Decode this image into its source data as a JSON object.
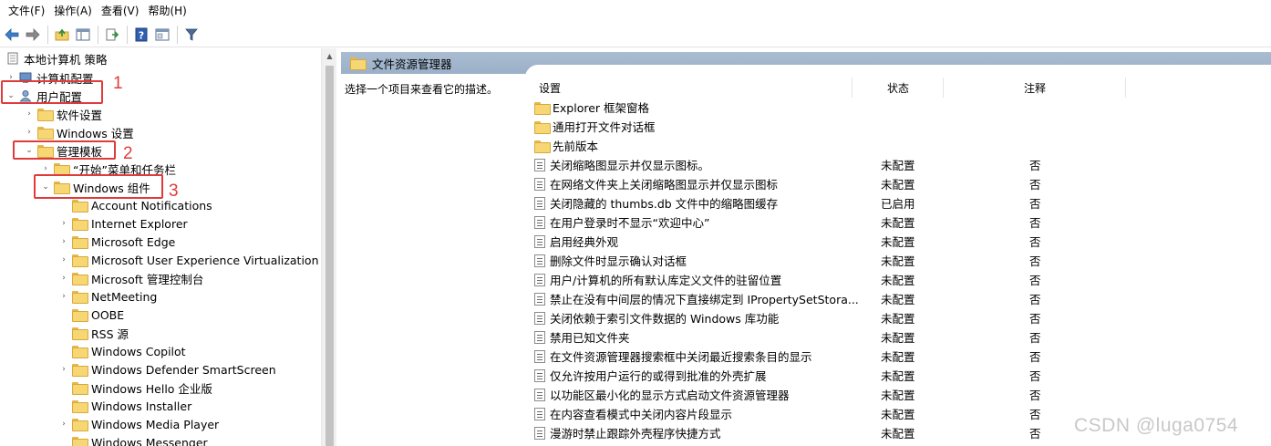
{
  "menu": [
    "文件(F)",
    "操作(A)",
    "查看(V)",
    "帮助(H)"
  ],
  "toolbar": [
    "back-icon",
    "forward-icon",
    "up-folder-icon",
    "show-hide-tree-icon",
    "export-list-icon",
    "help-icon",
    "properties-icon",
    "filter-icon"
  ],
  "tree": {
    "root": "本地计算机 策略",
    "items": [
      {
        "label": "计算机配置",
        "expander": "›"
      },
      {
        "label": "用户配置",
        "expander": "⌄"
      },
      {
        "label": "软件设置",
        "expander": "›"
      },
      {
        "label": "Windows 设置",
        "expander": "›"
      },
      {
        "label": "管理模板",
        "expander": "⌄"
      },
      {
        "label": "“开始”菜单和任务栏",
        "expander": "›"
      },
      {
        "label": "Windows 组件",
        "expander": "⌄"
      },
      {
        "label": "Account Notifications",
        "expander": ""
      },
      {
        "label": "Internet Explorer",
        "expander": "›"
      },
      {
        "label": "Microsoft Edge",
        "expander": "›"
      },
      {
        "label": "Microsoft User Experience Virtualization",
        "expander": "›"
      },
      {
        "label": "Microsoft 管理控制台",
        "expander": "›"
      },
      {
        "label": "NetMeeting",
        "expander": "›"
      },
      {
        "label": "OOBE",
        "expander": ""
      },
      {
        "label": "RSS 源",
        "expander": ""
      },
      {
        "label": "Windows Copilot",
        "expander": ""
      },
      {
        "label": "Windows Defender SmartScreen",
        "expander": "›"
      },
      {
        "label": "Windows Hello 企业版",
        "expander": ""
      },
      {
        "label": "Windows Installer",
        "expander": ""
      },
      {
        "label": "Windows Media Player",
        "expander": "›"
      },
      {
        "label": "Windows Messenger",
        "expander": ""
      }
    ]
  },
  "annotations": [
    "1",
    "2",
    "3"
  ],
  "details": {
    "header": "文件资源管理器",
    "description": "选择一个项目来查看它的描述。",
    "columns": {
      "setting": "设置",
      "state": "状态",
      "note": "注释"
    },
    "folders": [
      "Explorer 框架窗格",
      "通用打开文件对话框",
      "先前版本"
    ],
    "rows": [
      {
        "name": "关闭缩略图显示并仅显示图标。",
        "state": "未配置",
        "note": "否"
      },
      {
        "name": "在网络文件夹上关闭缩略图显示并仅显示图标",
        "state": "未配置",
        "note": "否"
      },
      {
        "name": "关闭隐藏的 thumbs.db 文件中的缩略图缓存",
        "state": "已启用",
        "note": "否"
      },
      {
        "name": "在用户登录时不显示“欢迎中心”",
        "state": "未配置",
        "note": "否"
      },
      {
        "name": "启用经典外观",
        "state": "未配置",
        "note": "否"
      },
      {
        "name": "删除文件时显示确认对话框",
        "state": "未配置",
        "note": "否"
      },
      {
        "name": "用户/计算机的所有默认库定义文件的驻留位置",
        "state": "未配置",
        "note": "否"
      },
      {
        "name": "禁止在没有中间层的情况下直接绑定到 IPropertySetStora...",
        "state": "未配置",
        "note": "否"
      },
      {
        "name": "关闭依赖于索引文件数据的 Windows 库功能",
        "state": "未配置",
        "note": "否"
      },
      {
        "name": "禁用已知文件夹",
        "state": "未配置",
        "note": "否"
      },
      {
        "name": "在文件资源管理器搜索框中关闭最近搜索条目的显示",
        "state": "未配置",
        "note": "否"
      },
      {
        "name": "仅允许按用户运行的或得到批准的外壳扩展",
        "state": "未配置",
        "note": "否"
      },
      {
        "name": "以功能区最小化的显示方式启动文件资源管理器",
        "state": "未配置",
        "note": "否"
      },
      {
        "name": "在内容查看模式中关闭内容片段显示",
        "state": "未配置",
        "note": "否"
      },
      {
        "name": "漫游时禁止跟踪外壳程序快捷方式",
        "state": "未配置",
        "note": "否"
      }
    ]
  },
  "watermark": "CSDN @luga0754",
  "colors": {
    "annotation": "#e03b3b",
    "header_band": "#a9bcd2"
  }
}
